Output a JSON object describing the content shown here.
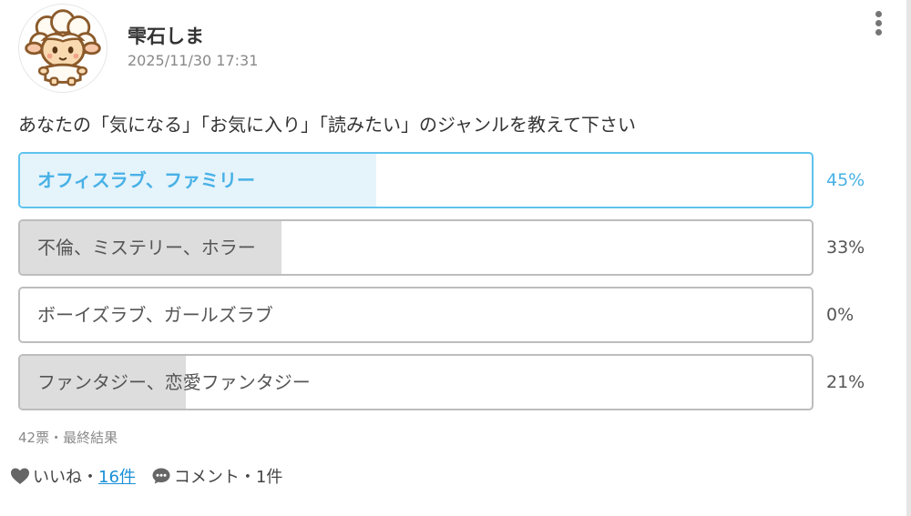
{
  "post": {
    "author": "雫石しま",
    "timestamp": "2025/11/30 17:31",
    "avatar_icon": "sheep-avatar-icon",
    "menu_icon": "kebab-menu-icon"
  },
  "poll": {
    "question": "あなたの「気になる」「お気に入り」「読みたい」のジャンルを教えて下さい",
    "options": [
      {
        "label": "オフィスラブ、ファミリー",
        "percent_text": "45%",
        "fraction": 0.45,
        "selected": true
      },
      {
        "label": "不倫、ミステリー、ホラー",
        "percent_text": "33%",
        "fraction": 0.33,
        "selected": false
      },
      {
        "label": "ボーイズラブ、ガールズラブ",
        "percent_text": "0%",
        "fraction": 0.0,
        "selected": false
      },
      {
        "label": "ファンタジー、恋愛ファンタジー",
        "percent_text": "21%",
        "fraction": 0.21,
        "selected": false
      }
    ],
    "summary": "42票・最終結果"
  },
  "reactions": {
    "like_label": "いいね・",
    "like_count": "16件",
    "comment_label": "コメント・1件",
    "like_icon": "heart-icon",
    "comment_icon": "speech-bubble-icon"
  },
  "colors": {
    "accent": "#47b1e6",
    "selected_border": "#5ec3ee",
    "selected_fill": "#e5f3fb",
    "result_fill": "#dddddd",
    "option_border": "#bdbdbd",
    "link": "#1a8fd8"
  }
}
